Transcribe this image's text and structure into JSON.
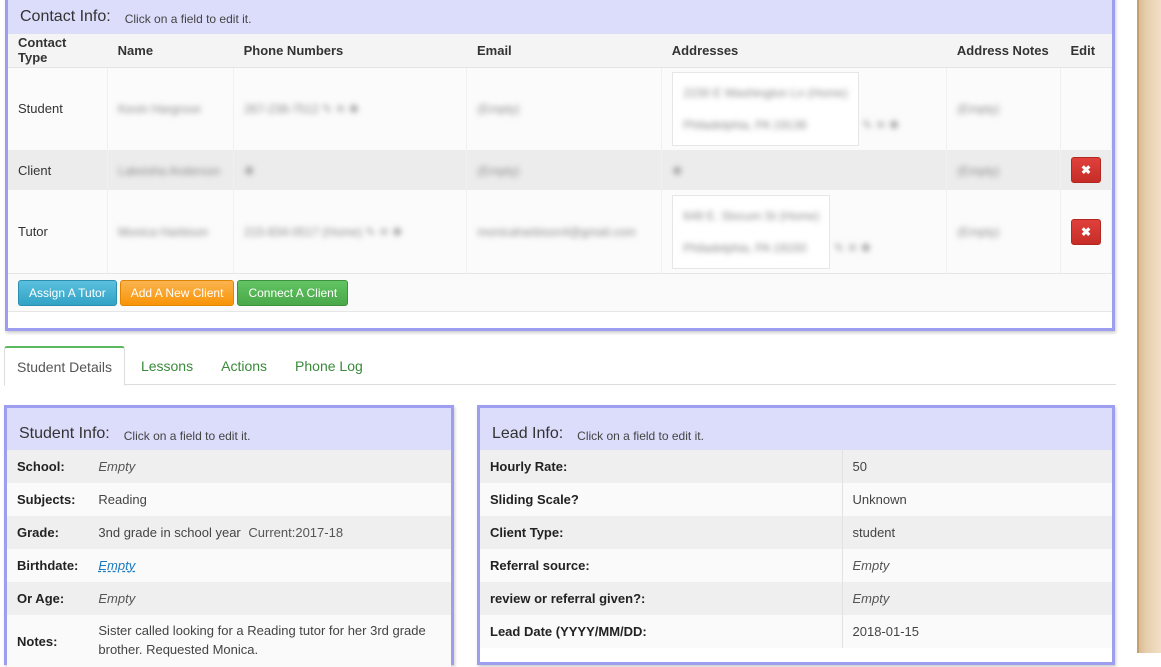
{
  "contact": {
    "title": "Contact Info:",
    "hint": "Click on a field to edit it.",
    "headers": [
      "Contact Type",
      "Name",
      "Phone Numbers",
      "Email",
      "Addresses",
      "Address Notes",
      "Edit"
    ],
    "rows": [
      {
        "type": "Student",
        "name": "Kevin Hargrove",
        "phone": "267-238-7512  ✎ ✕ ✚",
        "email": "(Empty)",
        "addr1": "2230 E Washington Ln (Home)",
        "addr2": "Philadelphia, PA 19138",
        "addr_actions": "✎ ✕ ✚",
        "notes": "(Empty)"
      },
      {
        "type": "Client",
        "name": "Lakeisha Anderson",
        "phone": "✚",
        "email": "(Empty)",
        "addr1": "✚",
        "addr2": "",
        "addr_actions": "",
        "notes": "(Empty)",
        "delete": "✖"
      },
      {
        "type": "Tutor",
        "name": "Monica Harbison",
        "phone": "215-834-0517 (Home)  ✎ ✕ ✚",
        "email": "monicaharbison4@gmail.com",
        "addr1": "649 E. Slocum St (Home)",
        "addr2": "Philadelphia, PA 19150",
        "addr_actions": "✎ ✕ ✚",
        "notes": "(Empty)",
        "delete": "✖"
      }
    ],
    "buttons": {
      "assign": "Assign A Tutor",
      "add_client": "Add A New Client",
      "connect": "Connect A Client"
    }
  },
  "tabs": [
    "Student Details",
    "Lessons",
    "Actions",
    "Phone Log"
  ],
  "student": {
    "title": "Student Info:",
    "hint": "Click on a field to edit it.",
    "school_label": "School:",
    "school": "Empty",
    "subjects_label": "Subjects:",
    "subjects": "Reading",
    "grade_label": "Grade:",
    "grade": "3nd grade in school year",
    "grade_current": "Current:2017-18",
    "birthdate_label": "Birthdate:",
    "birthdate": "Empty",
    "age_label": "Or Age:",
    "age": "Empty",
    "notes_label": "Notes:",
    "notes": "Sister called looking for a Reading tutor for her 3rd grade brother. Requested Monica."
  },
  "lead": {
    "title": "Lead Info:",
    "hint": "Click on a field to edit it.",
    "rows": [
      {
        "label": "Hourly Rate:",
        "value": "50"
      },
      {
        "label": "Sliding Scale?",
        "value": "Unknown"
      },
      {
        "label": "Client Type:",
        "value": "student"
      },
      {
        "label": "Referral source:",
        "value": "Empty"
      },
      {
        "label": "review or referral given?:",
        "value": "Empty"
      },
      {
        "label": "Lead Date (YYYY/MM/DD:",
        "value": "2018-01-15"
      }
    ]
  }
}
